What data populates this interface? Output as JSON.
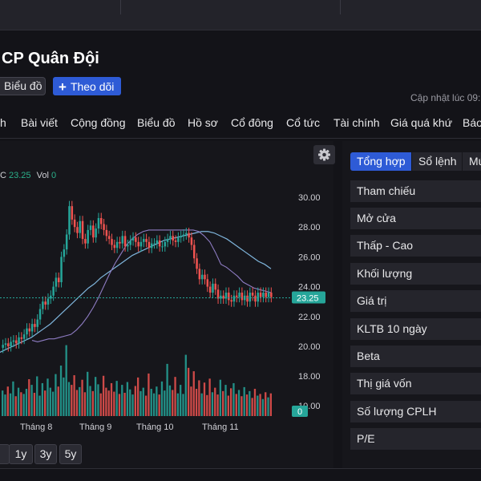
{
  "header": {
    "company_name": "CP Quân Đội",
    "chart_button": "Biểu đồ",
    "follow_button": "Theo dõi",
    "updated_text": "Cập nhật lúc  09:"
  },
  "nav": {
    "tabs": [
      "h",
      "Bài viết",
      "Cộng đồng",
      "Biểu đồ",
      "Hồ sơ",
      "Cổ đông",
      "Cổ tức",
      "Tài chính",
      "Giá quá khứ",
      "Báo"
    ]
  },
  "chart": {
    "legend_c_label": "C",
    "legend_c_value": "23.25",
    "legend_vol_label": "Vol",
    "legend_vol_value": "0",
    "price_badge": "23.25",
    "volume_badge": "0",
    "colors": {
      "up": "#26a69a",
      "down": "#ef5350",
      "ma_short": "#8e7cc3",
      "ma_long": "#7fb5dc"
    }
  },
  "chart_data": {
    "type": "candlestick",
    "ylim": [
      8,
      31
    ],
    "yticks": [
      "30.00",
      "28.00",
      "26.00",
      "24.00",
      "22.00",
      "20.00",
      "18.00",
      "10.00"
    ],
    "xticks": [
      "Tháng 8",
      "Tháng 9",
      "Tháng 10",
      "Tháng 11"
    ],
    "last_price": 23.25,
    "close": [
      20.1,
      20.2,
      20.0,
      20.3,
      20.4,
      20.2,
      20.6,
      20.5,
      20.8,
      21.2,
      21.0,
      21.5,
      21.3,
      21.8,
      22.5,
      23.0,
      22.8,
      23.2,
      23.4,
      24.0,
      24.6,
      24.3,
      26.0,
      26.5,
      27.5,
      29.4,
      28.5,
      28.0,
      27.6,
      28.4,
      27.2,
      26.9,
      27.8,
      28.1,
      27.3,
      27.9,
      28.6,
      28.2,
      27.8,
      27.4,
      27.2,
      26.8,
      26.6,
      27.0,
      26.9,
      27.4,
      26.7,
      26.8,
      27.1,
      27.3,
      27.0,
      26.7,
      27.0,
      27.2,
      27.0,
      26.6,
      26.9,
      26.9,
      27.1,
      26.7,
      26.7,
      27.0,
      27.2,
      27.4,
      27.1,
      27.0,
      27.3,
      27.4,
      27.5,
      27.6,
      27.3,
      26.8,
      25.9,
      25.2,
      24.5,
      24.8,
      24.5,
      24.0,
      23.6,
      24.2,
      23.8,
      23.2,
      23.4,
      23.2,
      23.6,
      23.1,
      23.0,
      23.4,
      23.3,
      23.6,
      23.1,
      23.4,
      23.0,
      23.6,
      23.4,
      23.0,
      23.6,
      23.3,
      23.6,
      23.3,
      23.6,
      23.3
    ],
    "ma_short": [
      20.4,
      20.3,
      20.4,
      20.5,
      20.5,
      20.6,
      20.7,
      20.8,
      21.1,
      21.5,
      22.0,
      22.6,
      23.3,
      24.1,
      24.9,
      25.6,
      26.2,
      26.8,
      27.2,
      27.5,
      27.7,
      27.8,
      27.8,
      27.8,
      27.8,
      27.8,
      27.8,
      27.8,
      27.8,
      27.8,
      27.7,
      27.4,
      27.0,
      26.3,
      25.5,
      25.3,
      25.0,
      24.7,
      24.3,
      24.1,
      23.9,
      23.8,
      23.7,
      23.6
    ],
    "ma_long": [
      19.6,
      19.8,
      20.0,
      20.2,
      20.4,
      20.6,
      20.9,
      21.2,
      21.5,
      21.9,
      22.3,
      22.7,
      23.1,
      23.5,
      23.9,
      24.2,
      24.6,
      24.9,
      25.2,
      25.5,
      25.8,
      26.1,
      26.3,
      26.5,
      26.7,
      26.9,
      27.1,
      27.2,
      27.3,
      27.4,
      27.5,
      27.6,
      27.7,
      27.7,
      27.6,
      27.4,
      27.2,
      26.9,
      26.6,
      26.3,
      26.0,
      25.7,
      25.5,
      25.2
    ],
    "volume": [
      4.5,
      3.8,
      5.2,
      4.0,
      6.1,
      3.5,
      5.0,
      4.2,
      3.9,
      4.8,
      6.5,
      5.5,
      4.1,
      7.0,
      3.6,
      5.8,
      4.5,
      6.6,
      5.0,
      4.3,
      7.4,
      5.2,
      8.9,
      6.8,
      12.5,
      6.0,
      5.5,
      7.2,
      4.6,
      5.1,
      6.4,
      4.2,
      7.8,
      5.3,
      4.4,
      6.9,
      5.6,
      4.0,
      7.1,
      5.0,
      4.5,
      5.8,
      4.3,
      6.2,
      3.9,
      5.5,
      4.1,
      6.0,
      4.7,
      3.8,
      5.3,
      6.8,
      4.4,
      5.0,
      3.6,
      7.5,
      4.8,
      4.0,
      5.2,
      3.8,
      6.1,
      4.5,
      9.2,
      5.4,
      4.6,
      6.9,
      4.0,
      5.5,
      3.9,
      10.8,
      8.5,
      5.2,
      7.9,
      4.8,
      6.3,
      4.0,
      5.9,
      3.7,
      6.6,
      4.2,
      5.0,
      3.8,
      6.4,
      4.4,
      5.5,
      3.6,
      4.9,
      5.8,
      3.9,
      4.6,
      3.5,
      5.1,
      3.8,
      4.4,
      3.2,
      4.8,
      3.6,
      3.9,
      3.0,
      4.2,
      3.3,
      4.0
    ]
  },
  "summary_tabs": [
    "Tổng hợp",
    "Sổ lệnh",
    "Mứ"
  ],
  "summary_rows": [
    "Tham chiếu",
    "Mở cửa",
    "Thấp - Cao",
    "Khối lượng",
    "Giá trị",
    "KLTB 10 ngày",
    "Beta",
    "Thị giá vốn",
    "Số lượng CPLH",
    "P/E"
  ],
  "ranges": [
    "1y",
    "3y",
    "5y"
  ],
  "icons": [
    "plus-icon",
    "gear-icon"
  ]
}
